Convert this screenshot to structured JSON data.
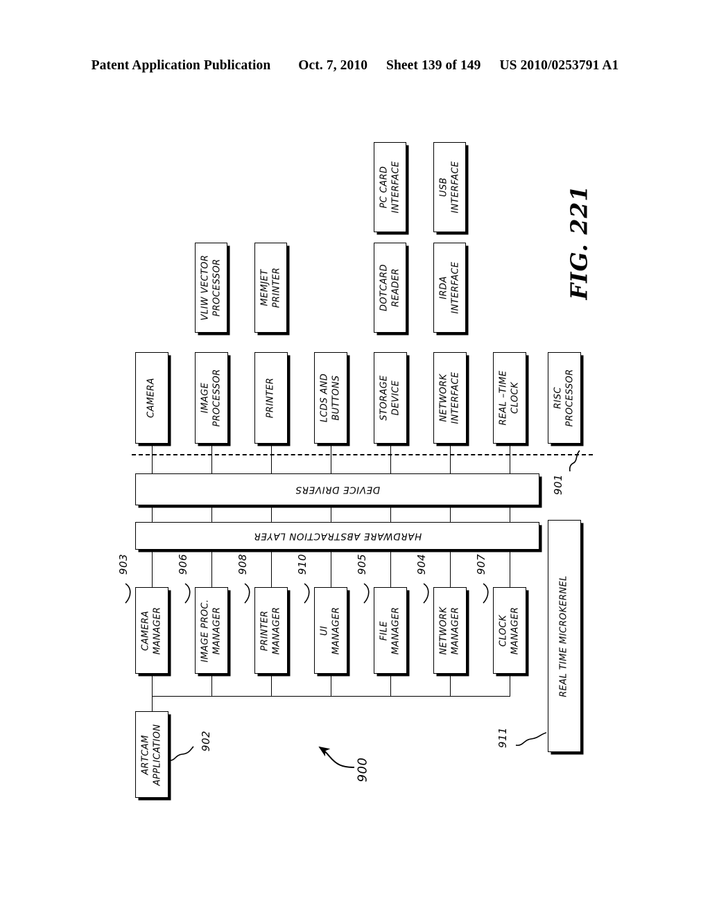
{
  "header": {
    "publication": "Patent Application Publication",
    "date": "Oct. 7, 2010",
    "sheet": "Sheet 139 of 149",
    "number": "US 2010/0253791 A1"
  },
  "figure": {
    "caption": "FIG. 221",
    "system_ref": "900"
  },
  "peripherals_top": [
    {
      "label": "PC CARD\nINTERFACE",
      "name": "pc-card-interface"
    },
    {
      "label": "USB\nINTERFACE",
      "name": "usb-interface"
    }
  ],
  "peripherals_second": [
    {
      "label": "VLIW VECTOR\nPROCESSOR",
      "name": "vliw-vector-processor"
    },
    {
      "label": "MEMJET\nPRINTER",
      "name": "memjet-printer"
    },
    {
      "label": "DOTCARD\nREADER",
      "name": "dotcard-reader"
    },
    {
      "label": "IRDA\nINTERFACE",
      "name": "irda-interface"
    }
  ],
  "devices": [
    {
      "label": "CAMERA",
      "name": "camera"
    },
    {
      "label": "IMAGE\nPROCESSOR",
      "name": "image-processor"
    },
    {
      "label": "PRINTER",
      "name": "printer"
    },
    {
      "label": "LCDS AND\nBUTTONS",
      "name": "lcds-and-buttons"
    },
    {
      "label": "STORAGE\nDEVICE",
      "name": "storage-device"
    },
    {
      "label": "NETWORK\nINTERFACE",
      "name": "network-interface"
    },
    {
      "label": "REAL –TIME\nCLOCK",
      "name": "real-time-clock"
    },
    {
      "label": "RISC\nPROCESSOR",
      "name": "risc-processor"
    }
  ],
  "layers": {
    "device_drivers": "DEVICE DRIVERS",
    "hardware_abstraction_layer": "HARDWARE ABSTRACTION LAYER",
    "hardware_boundary_ref": "901"
  },
  "managers": [
    {
      "label": "CAMERA\nMANAGER",
      "ref": "903",
      "name": "camera-manager"
    },
    {
      "label": "IMAGE PROC.\nMANAGER",
      "ref": "906",
      "name": "image-proc-manager"
    },
    {
      "label": "PRINTER\nMANAGER",
      "ref": "908",
      "name": "printer-manager"
    },
    {
      "label": "UI\nMANAGER",
      "ref": "910",
      "name": "ui-manager"
    },
    {
      "label": "FILE\nMANAGER",
      "ref": "905",
      "name": "file-manager"
    },
    {
      "label": "NETWORK\nMANAGER",
      "ref": "904",
      "name": "network-manager"
    },
    {
      "label": "CLOCK\nMANAGER",
      "ref": "907",
      "name": "clock-manager"
    }
  ],
  "application": {
    "label": "ARTCAM\nAPPLICATION",
    "ref": "902"
  },
  "microkernel": {
    "label": "REAL TIME MICROKERNEL",
    "ref": "911"
  }
}
